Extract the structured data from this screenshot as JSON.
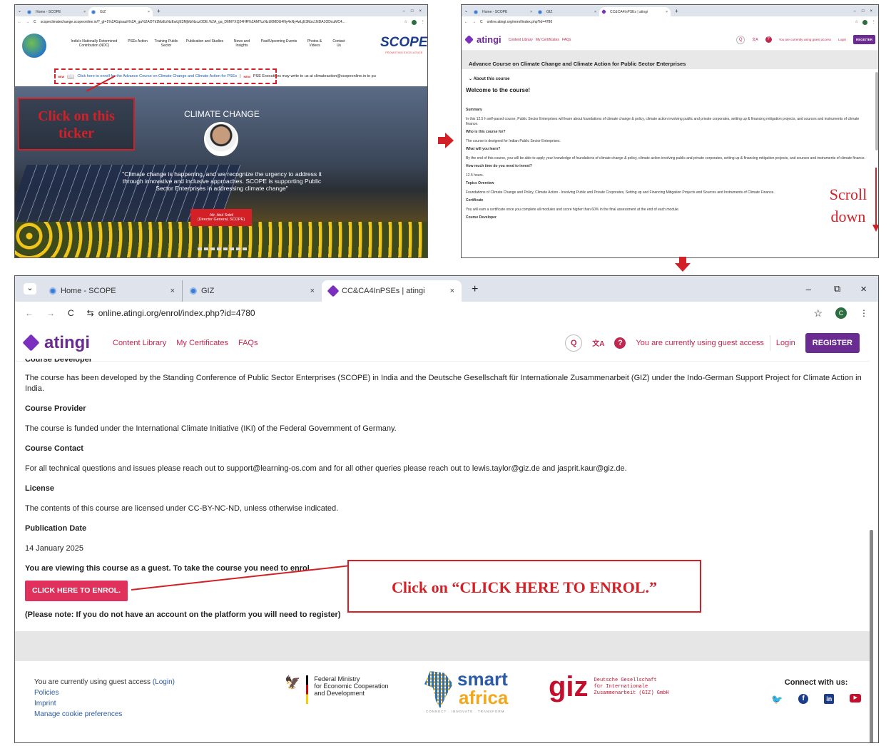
{
  "panel1": {
    "tabs": [
      {
        "label": "Home - SCOPE"
      },
      {
        "label": "GIZ"
      }
    ],
    "url": "scopeclimatechange.scopeonline.in/?_gl=1%2A1qisauh%2A_ga%2AOTk1MzEzNzEwLjE3MjMzNzczODE.%2A_ga_D6MYXQ24HR%2AMTczNzU0MDU4Ny4xNy4wLjE3Mzc1NDA1ODcuMC4...",
    "nav_items": [
      "India's Nationally Determined Contribution (NDC)",
      "PSEs Action",
      "Training Public Sector",
      "Publication and Studies",
      "News and Insights",
      "Past/Upcoming Events",
      "Photos & Videos",
      "Contact Us"
    ],
    "logo_text": "SCOPE",
    "logo_sub": "PROMOTING EXCELLENCE",
    "ticker_text": "Click here to enroll for the Advance Course on Climate Change and Climate Action for PSEs",
    "ticker_text2": "PSE Executives may write to us at climateaction@scopeonline.in to pu",
    "ticker_badge": "NEW",
    "hero_title": "CLIMATE CHANGE",
    "hero_quote": "\"Climate change is happening, and we recognize the urgency to address it through innovative and inclusive approaches. SCOPE is supporting Public Sector Enterprises in addressing climate change\"",
    "hero_name": "-Mr. Atul Sobti",
    "hero_role": "(Director General, SCOPE)",
    "annotation": "Click on this ticker"
  },
  "panel2": {
    "tabs": [
      {
        "label": "Home - SCOPE"
      },
      {
        "label": "GIZ"
      },
      {
        "label": "CC&CA4InPSEs | atingi"
      }
    ],
    "url": "online.atingi.org/enrol/index.php?id=4780",
    "brand": "atingi",
    "nav": [
      "Content Library",
      "My Certificates",
      "FAQs"
    ],
    "guest_text": "You are currently using guest access",
    "login": "Login",
    "register": "REGISTER",
    "course_title": "Advance Course on Climate Change and Climate Action for Public Sector Enterprises",
    "about": "About this course",
    "welcome": "Welcome to the course!",
    "sections": [
      {
        "h": "Summary",
        "t": "In this 12.5 h self-paced course, Public Sector Enterprises will learn about foundations of climate change & policy, climate action involving public and private corporates, setting up & financing mitigation projects, and sources and instruments of climate finance."
      },
      {
        "h": "Who is this course for?",
        "t": "The course is designed for Indian Public Sector Enterprises."
      },
      {
        "h": "What will you learn?",
        "t": "By the end of this course, you will be able to apply your knowledge of foundations of climate change & policy, climate action involving public and private corporates, setting up & financing mitigation projects, and sources and instruments of climate finance."
      },
      {
        "h": "How much time do you need to invest?",
        "t": "12.5 hours."
      },
      {
        "h": "Topics Overview",
        "t": "Foundations of Climate Change and Policy, Climate Action - Involving Public and Private Corporates, Setting up and Financing Mitigation Projects and Sources and Instruments of Climate Finance."
      },
      {
        "h": "Certificate",
        "t": "You will earn a certificate once you complete all modules and score higher than 60% in the final assessment at the end of each module."
      },
      {
        "h": "Course Developer",
        "t": ""
      }
    ],
    "annotation_l1": "Scroll",
    "annotation_l2": "down"
  },
  "panel3": {
    "tabs": [
      {
        "label": "Home - SCOPE"
      },
      {
        "label": "GIZ"
      },
      {
        "label": "CC&CA4InPSEs | atingi"
      }
    ],
    "url": "online.atingi.org/enrol/index.php?id=4780",
    "profile_initial": "C",
    "brand": "atingi",
    "nav": [
      "Content Library",
      "My Certificates",
      "FAQs"
    ],
    "guest_text": "You are currently using guest access",
    "login": "Login",
    "register": "REGISTER",
    "partial_heading": "Course Developer",
    "developer_text": "The course has been developed by the Standing Conference of Public Sector Enterprises (SCOPE) in India and the Deutsche Gesellschaft für Internationale Zusammenarbeit (GIZ) under the Indo-German Support Project for Climate Action in India.",
    "sections": [
      {
        "h": "Course Provider",
        "t": "The course is funded under the International Climate Initiative (IKI) of the Federal Government of Germany."
      },
      {
        "h": "Course Contact",
        "t": "For all technical questions and issues please reach out to support@learning-os.com and for all other queries please reach out to lewis.taylor@giz.de and jasprit.kaur@giz.de."
      },
      {
        "h": "License",
        "t": "The contents of this course are licensed under CC-BY-NC-ND, unless otherwise indicated."
      },
      {
        "h": "Publication Date",
        "t": "14 January 2025"
      }
    ],
    "guest_notice": "You are viewing this course as a guest. To take the course you need to enrol.",
    "enrol_button": "CLICK HERE TO ENROL.",
    "note": "(Please note: If you do not have an account on the platform you will need to register)",
    "annotation": "Click on “CLICK HERE TO ENROL.”",
    "footer": {
      "guest_prefix": "You are currently using guest access",
      "guest_login": "(Login)",
      "links": [
        "Policies",
        "Imprint",
        "Manage cookie preferences"
      ],
      "bmz_l1": "Federal Ministry",
      "bmz_l2": "for Economic Cooperation",
      "bmz_l3": "and Development",
      "smart": "smart",
      "africa": "africa",
      "smart_tag": "CONNECT . INNOVATE . TRANSFORM",
      "giz": "giz",
      "giz_l1": "Deutsche Gesellschaft",
      "giz_l2": "für Internationale",
      "giz_l3": "Zusammenarbeit (GIZ) GmbH",
      "connect": "Connect with us:"
    }
  },
  "colors": {
    "accent_red": "#d32026",
    "atingi_purple": "#6a2c91",
    "enrol_pink": "#e0315c",
    "link_pink": "#c0284f"
  }
}
